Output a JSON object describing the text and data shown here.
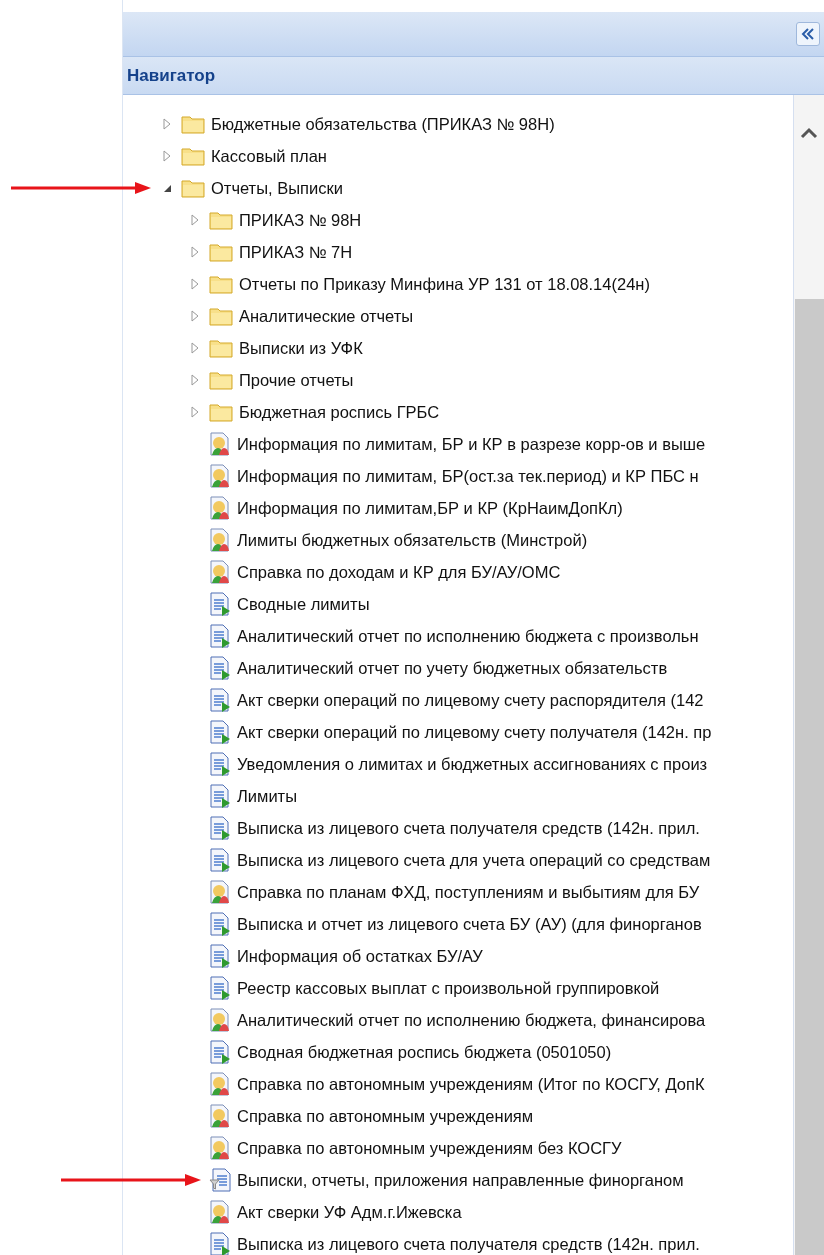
{
  "panel": {
    "title": "Навигатор"
  },
  "tree": [
    {
      "kind": "folder",
      "label": "Бюджетные обязательства (ПРИКАЗ № 98Н)",
      "expanded": false,
      "marked": false
    },
    {
      "kind": "folder",
      "label": "Кассовый план",
      "expanded": false,
      "marked": false
    },
    {
      "kind": "folder",
      "label": "Отчеты, Выписки",
      "expanded": true,
      "marked": true,
      "children": [
        {
          "kind": "folder",
          "label": "ПРИКАЗ № 98Н",
          "expanded": false,
          "marked": false
        },
        {
          "kind": "folder",
          "label": "ПРИКАЗ № 7Н",
          "expanded": false,
          "marked": false
        },
        {
          "kind": "folder",
          "label": "Отчеты по Приказу Минфина УР 131 от 18.08.14(24н)",
          "expanded": false,
          "marked": false
        },
        {
          "kind": "folder",
          "label": "Аналитические отчеты",
          "expanded": false,
          "marked": false
        },
        {
          "kind": "folder",
          "label": "Выписки из УФК",
          "expanded": false,
          "marked": false
        },
        {
          "kind": "folder",
          "label": "Прочие отчеты",
          "expanded": false,
          "marked": false
        },
        {
          "kind": "folder",
          "label": "Бюджетная роспись ГРБС",
          "expanded": false,
          "marked": false
        },
        {
          "kind": "report",
          "label": "Информация по лимитам, БР и КР в разрезе корр-ов и выше",
          "marked": false
        },
        {
          "kind": "report",
          "label": "Информация по лимитам, БР(ост.за тек.период) и КР ПБС н",
          "marked": false
        },
        {
          "kind": "report",
          "label": "Информация по лимитам,БР и КР (КрНаимДопКл)",
          "marked": false
        },
        {
          "kind": "report",
          "label": "Лимиты бюджетных обязательств (Минстрой)",
          "marked": false
        },
        {
          "kind": "report",
          "label": "Справка по доходам и КР для БУ/АУ/ОМС",
          "marked": false
        },
        {
          "kind": "document",
          "label": "Сводные лимиты",
          "marked": false
        },
        {
          "kind": "document",
          "label": "Аналитический отчет по исполнению бюджета с произвольн",
          "marked": false
        },
        {
          "kind": "document",
          "label": "Аналитический отчет по учету бюджетных обязательств",
          "marked": false
        },
        {
          "kind": "document",
          "label": "Акт сверки операций по лицевому счету распорядителя (142",
          "marked": false
        },
        {
          "kind": "document",
          "label": "Акт сверки операций по лицевому счету получателя (142н. пр",
          "marked": false
        },
        {
          "kind": "document",
          "label": "Уведомления о лимитах и бюджетных ассигнованиях с произ",
          "marked": false
        },
        {
          "kind": "document",
          "label": "Лимиты",
          "marked": false
        },
        {
          "kind": "document",
          "label": "Выписка из лицевого счета получателя средств (142н. прил.",
          "marked": false
        },
        {
          "kind": "document",
          "label": "Выписка из лицевого счета для учета операций со средствам",
          "marked": false
        },
        {
          "kind": "report",
          "label": "Справка по планам ФХД, поступлениям и выбытиям для БУ",
          "marked": false
        },
        {
          "kind": "document",
          "label": "Выписка и отчет из лицевого счета БУ (АУ) (для финорганов",
          "marked": false
        },
        {
          "kind": "document",
          "label": "Информация об остатках БУ/АУ",
          "marked": false
        },
        {
          "kind": "document",
          "label": "Реестр кассовых выплат с произвольной группировкой",
          "marked": false
        },
        {
          "kind": "report",
          "label": "Аналитический отчет по исполнению бюджета, финансирова",
          "marked": false
        },
        {
          "kind": "document",
          "label": "Сводная бюджетная роспись бюджета (0501050)",
          "marked": false
        },
        {
          "kind": "report",
          "label": "Справка по автономным учреждениям (Итог по КОСГУ, ДопК",
          "marked": false
        },
        {
          "kind": "report",
          "label": "Справка по автономным учреждениям",
          "marked": false
        },
        {
          "kind": "report",
          "label": "Справка по автономным учреждениям без КОСГУ",
          "marked": false
        },
        {
          "kind": "filter",
          "label": "Выписки, отчеты, приложения направленные финорганом",
          "marked": true
        },
        {
          "kind": "report",
          "label": "Акт сверки УФ Адм.г.Ижевска",
          "marked": false
        },
        {
          "kind": "document",
          "label": "Выписка из лицевого счета получателя средств (142н. прил.",
          "marked": false
        }
      ]
    }
  ]
}
